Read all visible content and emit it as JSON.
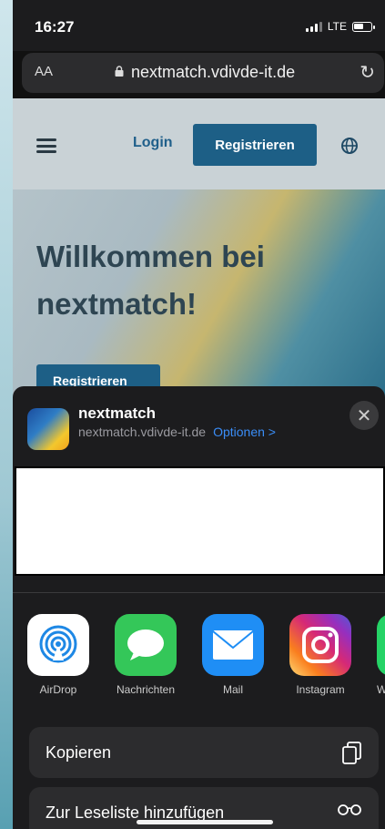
{
  "status": {
    "time": "16:27",
    "network": "LTE"
  },
  "browser": {
    "aa_label": "AA",
    "url": "nextmatch.vdivde-it.de"
  },
  "site": {
    "login": "Login",
    "register": "Registrieren",
    "hero_title": "Willkommen bei nextmatch!",
    "hero_button": "Registrieren"
  },
  "share": {
    "app_name": "nextmatch",
    "app_url": "nextmatch.vdivde-it.de",
    "options": "Optionen >",
    "targets": [
      {
        "label": "AirDrop",
        "icon": "airdrop-icon",
        "color": "#ffffff"
      },
      {
        "label": "Nachrichten",
        "icon": "messages-icon",
        "color": "#34c759"
      },
      {
        "label": "Mail",
        "icon": "mail-icon",
        "color": "#1f8ef5"
      },
      {
        "label": "Instagram",
        "icon": "instagram-icon",
        "color": "#d62976"
      },
      {
        "label": "W",
        "icon": "whatsapp-icon",
        "color": "#25d366"
      }
    ],
    "actions": [
      {
        "label": "Kopieren",
        "icon": "copy-icon"
      },
      {
        "label": "Zur Leseliste hinzufügen",
        "icon": "reading-glasses-icon"
      }
    ]
  }
}
